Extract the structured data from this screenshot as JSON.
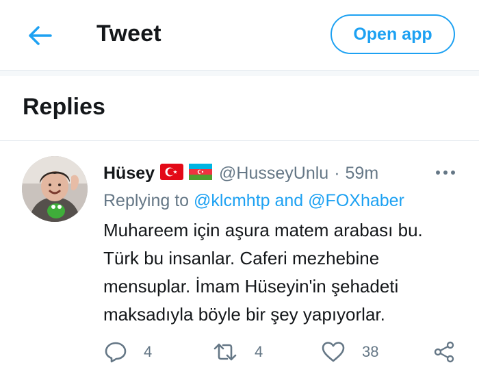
{
  "header": {
    "title": "Tweet",
    "open_app_label": "Open app"
  },
  "replies": {
    "title": "Replies"
  },
  "tweet": {
    "display_name": "Hüsey",
    "flags": [
      "turkey-flag",
      "azerbaijan-flag"
    ],
    "handle": "@HusseyUnlu",
    "separator": "·",
    "time": "59m",
    "replying_prefix": "Replying to",
    "mention_1": "@klcmhtp",
    "mention_and": "and",
    "mention_2": "@FOXhaber",
    "text": "Muhareem için aşura matem arabası bu. Türk bu insanlar. Caferi mezhebine mensuplar. İmam Hüseyin'in şehadeti maksadıyla böyle bir şey yapıyorlar.",
    "reply_count": "4",
    "retweet_count": "4",
    "like_count": "38"
  },
  "colors": {
    "accent": "#1da1f2",
    "secondary_text": "#657786",
    "primary_text": "#14171a",
    "divider": "#e1e8ed"
  }
}
